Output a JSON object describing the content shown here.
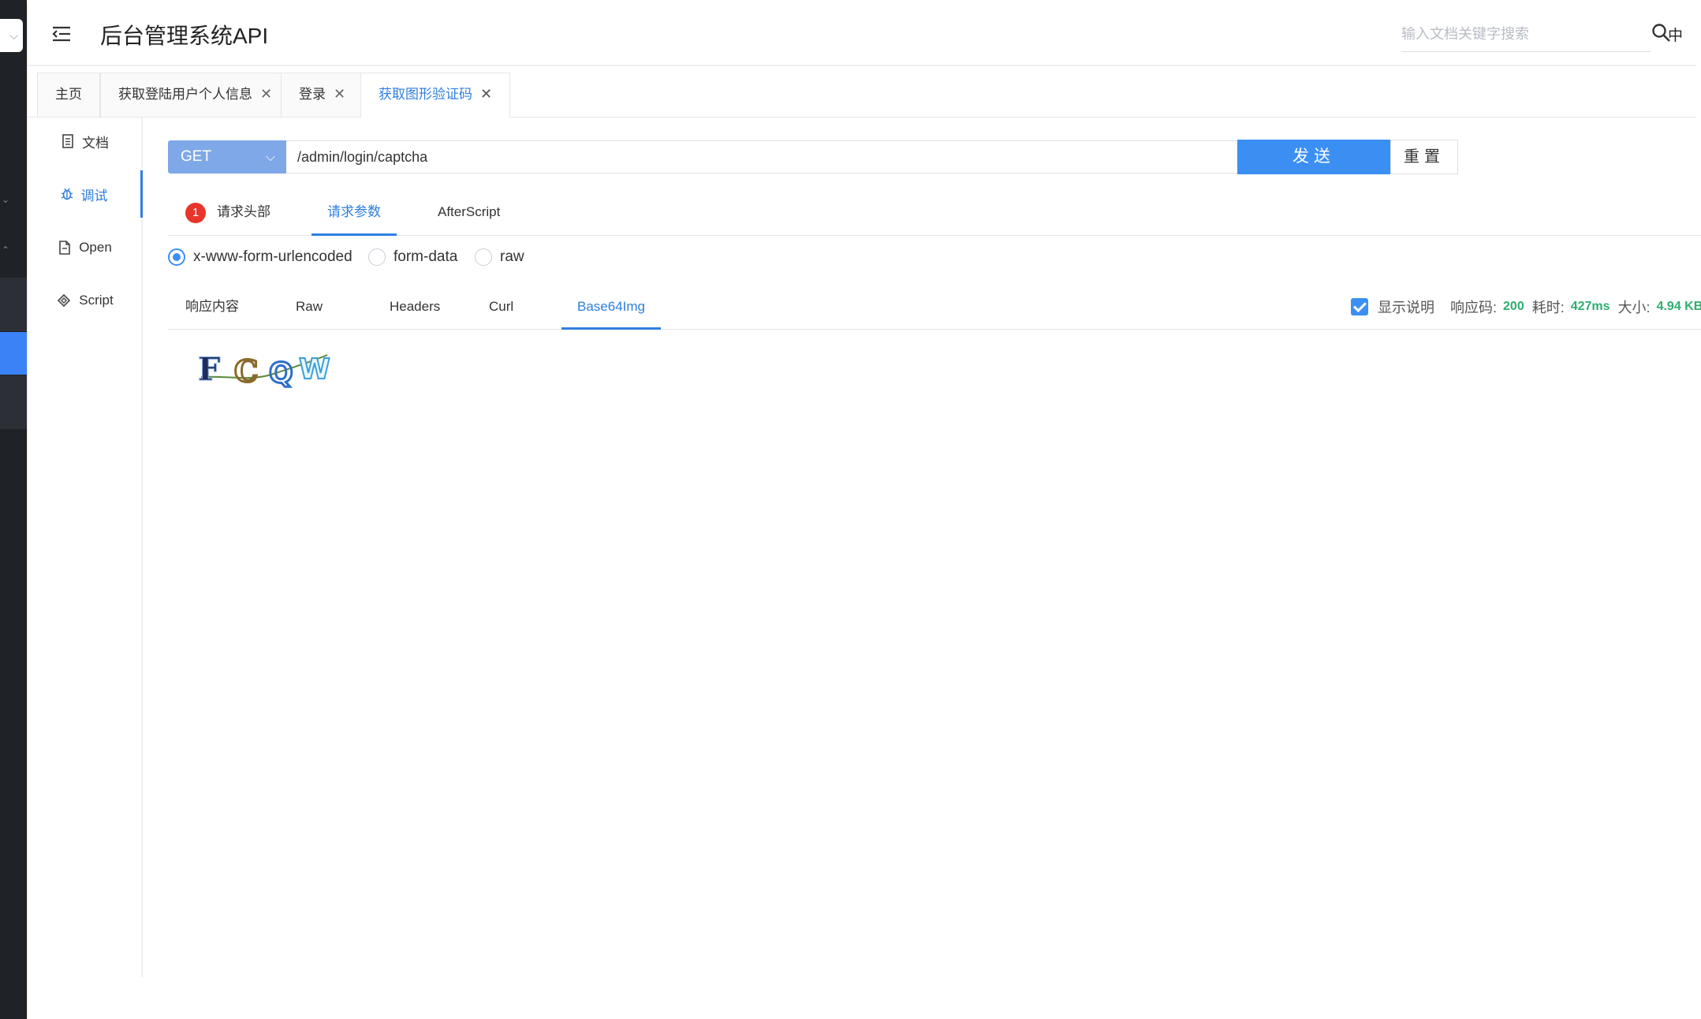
{
  "header": {
    "title": "后台管理系统API",
    "search_placeholder": "输入文档关键字搜索",
    "lang_label": "中"
  },
  "tabs": [
    {
      "label": "主页",
      "closable": false
    },
    {
      "label": "获取登陆用户个人信息",
      "closable": true
    },
    {
      "label": "登录",
      "closable": true
    },
    {
      "label": "获取图形验证码",
      "closable": true,
      "active": true
    }
  ],
  "side_nav": [
    {
      "label": "文档",
      "icon": "document-icon"
    },
    {
      "label": "调试",
      "icon": "bug-icon",
      "active": true
    },
    {
      "label": "Open",
      "icon": "file-icon"
    },
    {
      "label": "Script",
      "icon": "code-icon"
    }
  ],
  "request": {
    "method": "GET",
    "url": "/admin/login/captcha",
    "send_label": "发送",
    "reset_label": "重置"
  },
  "request_tabs": {
    "headers_badge": "1",
    "headers_label": "请求头部",
    "params_label": "请求参数",
    "afterscript_label": "AfterScript",
    "active": "请求参数"
  },
  "body_types": {
    "urlencoded": "x-www-form-urlencoded",
    "formdata": "form-data",
    "raw": "raw",
    "selected": "x-www-form-urlencoded"
  },
  "response_tabs": {
    "content": "响应内容",
    "raw": "Raw",
    "headers": "Headers",
    "curl": "Curl",
    "base64": "Base64Img",
    "active": "Base64Img"
  },
  "response_meta": {
    "show_desc_label": "显示说明",
    "show_desc_checked": true,
    "code_label": "响应码:",
    "code_value": "200",
    "time_label": "耗时:",
    "time_value": "427ms",
    "size_label": "大小:",
    "size_value": "4.94 KB"
  },
  "captcha_text": "FCQW",
  "colors": {
    "accent": "#3b8ff3",
    "method_bg": "#7fa8e8",
    "badge": "#e8342a",
    "meta_value": "#2fae6f"
  }
}
